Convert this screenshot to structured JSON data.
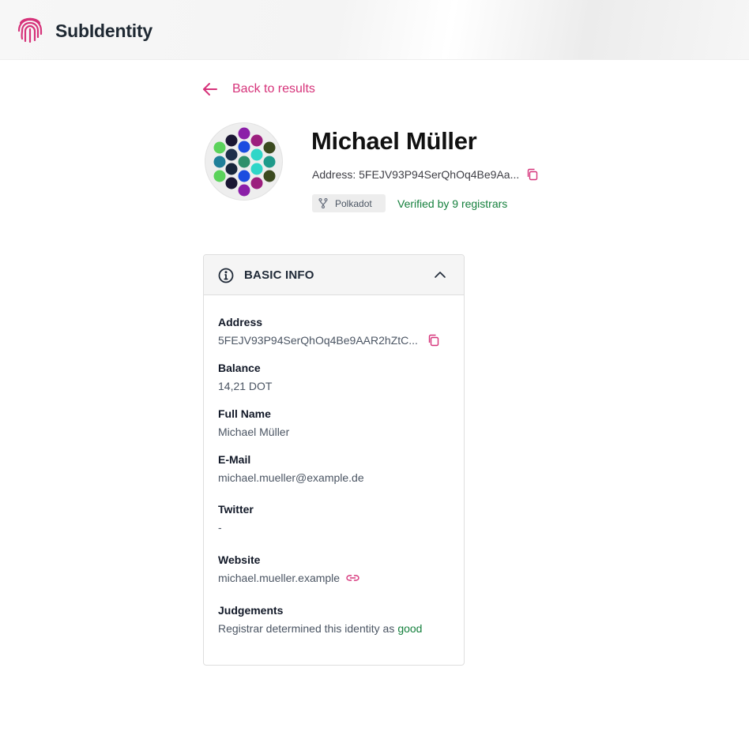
{
  "app": {
    "brand": "SubIdentity"
  },
  "nav": {
    "back_label": "Back to results"
  },
  "profile": {
    "name": "Michael Müller",
    "address_line": "Address: 5FEJV93P94SerQhOq4Be9Aa...",
    "network": "Polkadot",
    "verified": "Verified by 9 registrars"
  },
  "basic_info": {
    "title": "BASIC INFO",
    "address_label": "Address",
    "address_value": "5FEJV93P94SerQhOq4Be9AAR2hZtC...",
    "balance_label": "Balance",
    "balance_value": "14,21 DOT",
    "full_name_label": "Full Name",
    "full_name_value": "Michael Müller",
    "email_label": "E-Mail",
    "email_value": "michael.mueller@example.de",
    "twitter_label": "Twitter",
    "twitter_value": "-",
    "website_label": "Website",
    "website_value": "michael.mueller.example",
    "judgements_label": "Judgements",
    "judgements_text": "Registrar determined this identity as",
    "judgements_result": "good"
  },
  "colors": {
    "accent": "#d6337a",
    "verified_green": "#15803d"
  },
  "icons": {
    "logo": "fingerprint-icon",
    "back": "arrow-left-icon",
    "copy": "copy-icon",
    "network": "fork-icon",
    "info": "info-circle-icon",
    "collapse": "chevron-up-icon",
    "website": "link-icon"
  }
}
